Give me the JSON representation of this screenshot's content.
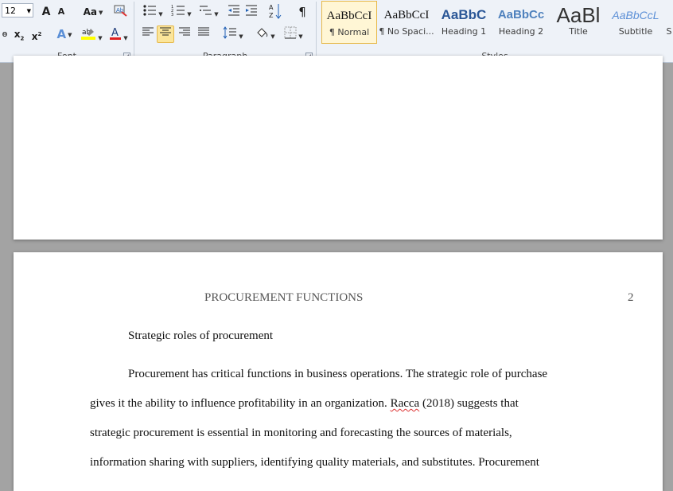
{
  "ribbon": {
    "font_group": {
      "label": "Font",
      "font_size": "12",
      "buttons": [
        "A",
        "A",
        "Aa",
        "A",
        "x",
        "x"
      ]
    },
    "paragraph_group": {
      "label": "Paragraph",
      "sort_glyph": "A Z",
      "pilcrow": "¶"
    },
    "styles_group": {
      "label": "Styles",
      "tiles": [
        {
          "preview": "AaBbCcI",
          "name": "¶ Normal",
          "selected": true
        },
        {
          "preview": "AaBbCcI",
          "name": "¶ No Spaci..."
        },
        {
          "preview": "AaBbC",
          "name": "Heading 1"
        },
        {
          "preview": "AaBbCc",
          "name": "Heading 2"
        },
        {
          "preview": "AaBl",
          "name": "Title"
        },
        {
          "preview": "AaBbCcL",
          "name": "Subtitle"
        },
        {
          "preview": "",
          "name": "S"
        }
      ]
    },
    "colors": {
      "highlight": "#ffff00",
      "font_color": "#e02020",
      "accent_blue": "#1f5fb4"
    }
  },
  "document": {
    "header_title": "PROCUREMENT FUNCTIONS",
    "page_number": "2",
    "heading": "Strategic roles of procurement",
    "body_lines": [
      "Procurement has critical functions in business operations. The strategic role of purchase",
      "gives it the ability to influence profitability in an organization.",
      "(2018) suggests that",
      "strategic procurement is essential in monitoring and forecasting the sources of materials,",
      "information sharing with suppliers, identifying quality materials, and substitutes. Procurement"
    ],
    "misspelled_word": "Racca"
  }
}
